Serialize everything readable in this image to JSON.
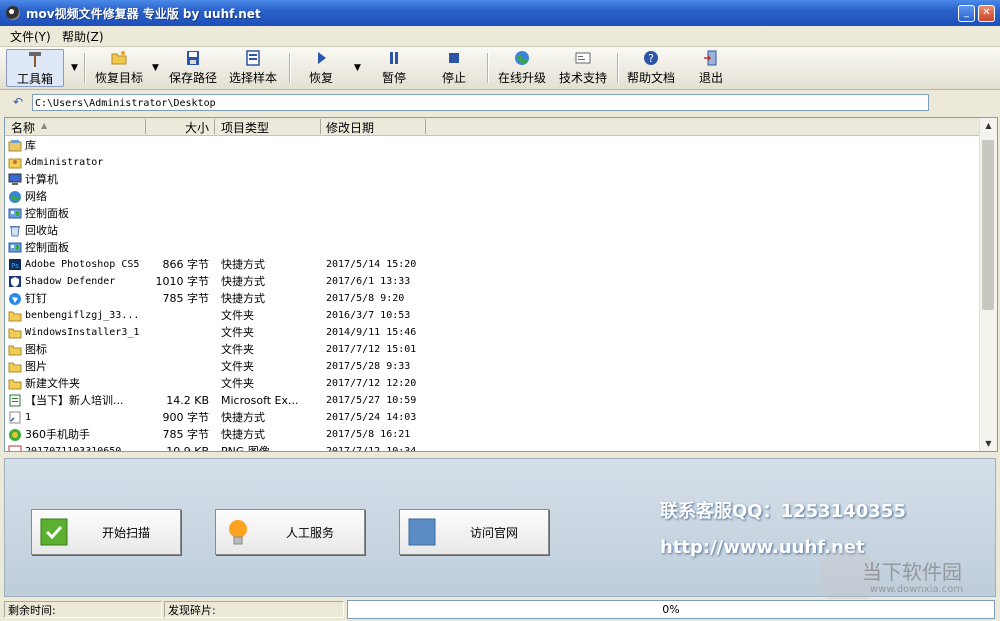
{
  "window": {
    "title": "mov视频文件修复器 专业版 by uuhf.net"
  },
  "menu": [
    "文件(Y)",
    "帮助(Z)"
  ],
  "toolbar": {
    "toolbox": "工具箱",
    "restore_target": "恢复目标",
    "save_path": "保存路径",
    "select_sample": "选择样本",
    "recover": "恢复",
    "pause": "暂停",
    "stop": "停止",
    "online_upgrade": "在线升级",
    "tech_support": "技术支持",
    "help_docs": "帮助文档",
    "exit": "退出"
  },
  "address": {
    "path": "C:\\Users\\Administrator\\Desktop"
  },
  "columns": {
    "name": "名称",
    "size": "大小",
    "type": "项目类型",
    "date": "修改日期"
  },
  "files": [
    {
      "name": "库",
      "size": "",
      "type": "",
      "date": "",
      "icon": "library-icon"
    },
    {
      "name": "Administrator",
      "size": "",
      "type": "",
      "date": "",
      "icon": "user-folder-icon"
    },
    {
      "name": "计算机",
      "size": "",
      "type": "",
      "date": "",
      "icon": "computer-icon"
    },
    {
      "name": "网络",
      "size": "",
      "type": "",
      "date": "",
      "icon": "network-icon"
    },
    {
      "name": "控制面板",
      "size": "",
      "type": "",
      "date": "",
      "icon": "control-panel-icon"
    },
    {
      "name": "回收站",
      "size": "",
      "type": "",
      "date": "",
      "icon": "recycle-bin-icon"
    },
    {
      "name": "控制面板",
      "size": "",
      "type": "",
      "date": "",
      "icon": "control-panel-icon"
    },
    {
      "name": "Adobe Photoshop CS5",
      "size": "866 字节",
      "type": "快捷方式",
      "date": "2017/5/14 15:20",
      "icon": "photoshop-icon"
    },
    {
      "name": "Shadow Defender",
      "size": "1010 字节",
      "type": "快捷方式",
      "date": "2017/6/1 13:33",
      "icon": "shield-icon"
    },
    {
      "name": "钉钉",
      "size": "785 字节",
      "type": "快捷方式",
      "date": "2017/5/8 9:20",
      "icon": "dingtalk-icon"
    },
    {
      "name": "benbengiflzgj_33...",
      "size": "",
      "type": "文件夹",
      "date": "2016/3/7 10:53",
      "icon": "folder-icon"
    },
    {
      "name": "WindowsInstaller3_1",
      "size": "",
      "type": "文件夹",
      "date": "2014/9/11 15:46",
      "icon": "folder-icon"
    },
    {
      "name": "图标",
      "size": "",
      "type": "文件夹",
      "date": "2017/7/12 15:01",
      "icon": "folder-icon"
    },
    {
      "name": "图片",
      "size": "",
      "type": "文件夹",
      "date": "2017/5/28 9:33",
      "icon": "folder-icon"
    },
    {
      "name": "新建文件夹",
      "size": "",
      "type": "文件夹",
      "date": "2017/7/12 12:20",
      "icon": "folder-icon"
    },
    {
      "name": "【当下】新人培训...",
      "size": "14.2 KB",
      "type": "Microsoft Ex...",
      "date": "2017/5/27 10:59",
      "icon": "excel-icon"
    },
    {
      "name": "1",
      "size": "900 字节",
      "type": "快捷方式",
      "date": "2017/5/24 14:03",
      "icon": "shortcut-icon"
    },
    {
      "name": "360手机助手",
      "size": "785 字节",
      "type": "快捷方式",
      "date": "2017/5/8 16:21",
      "icon": "app-360-icon"
    },
    {
      "name": "2017071103310650",
      "size": "10.9 KB",
      "type": "PNG 图像",
      "date": "2017/7/12 10:34",
      "icon": "image-icon"
    }
  ],
  "actions": {
    "start_scan": "开始扫描",
    "manual_service": "人工服务",
    "visit_site": "访问官网"
  },
  "contact": {
    "qq": "联系客服QQ：1253140355",
    "url": "http://www.uuhf.net"
  },
  "watermark": {
    "brand": "当下软件园",
    "url": "www.downxia.com"
  },
  "status": {
    "remaining_label": "剩余时间:",
    "fragments_label": "发现碎片:",
    "progress_text": "0%",
    "progress_value": 0
  }
}
